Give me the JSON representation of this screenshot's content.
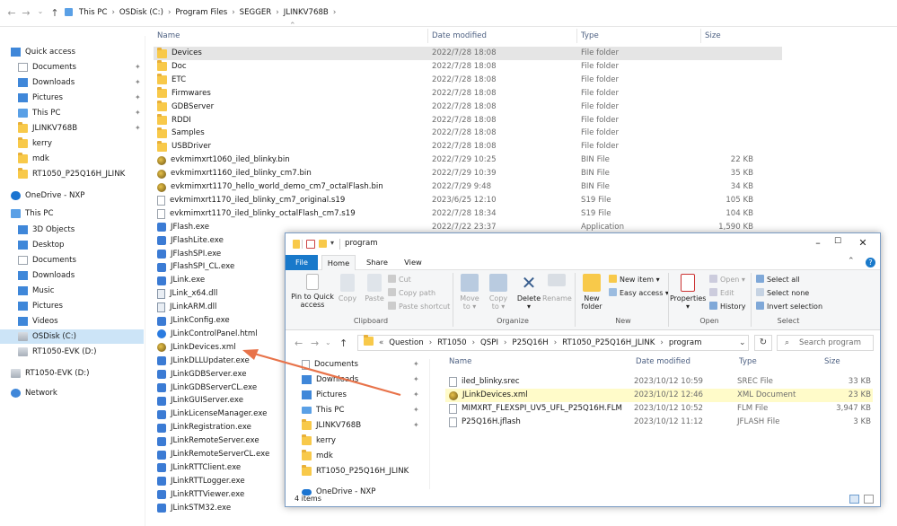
{
  "back": {
    "breadcrumb": [
      "This PC",
      "OSDisk (C:)",
      "Program Files",
      "SEGGER",
      "JLINKV768B"
    ],
    "columns": {
      "name": "Name",
      "date": "Date modified",
      "type": "Type",
      "size": "Size"
    },
    "nav": [
      {
        "label": "Quick access",
        "icon": "star-icon",
        "pin": false,
        "indent": 0
      },
      {
        "label": "Documents",
        "icon": "documents-icon",
        "pin": true,
        "indent": 1
      },
      {
        "label": "Downloads",
        "icon": "downloads-icon",
        "pin": true,
        "indent": 1
      },
      {
        "label": "Pictures",
        "icon": "pictures-icon",
        "pin": true,
        "indent": 1
      },
      {
        "label": "This PC",
        "icon": "this-pc-icon",
        "pin": true,
        "indent": 1
      },
      {
        "label": "JLINKV768B",
        "icon": "folder-icon",
        "pin": true,
        "indent": 1
      },
      {
        "label": "kerry",
        "icon": "folder-icon",
        "pin": false,
        "indent": 1
      },
      {
        "label": "mdk",
        "icon": "folder-icon",
        "pin": false,
        "indent": 1
      },
      {
        "label": "RT1050_P25Q16H_JLINK",
        "icon": "folder-icon",
        "pin": false,
        "indent": 1
      },
      {
        "label": "OneDrive - NXP",
        "icon": "cloud-icon",
        "pin": false,
        "indent": 0
      },
      {
        "label": "This PC",
        "icon": "this-pc-icon",
        "pin": false,
        "indent": 0
      },
      {
        "label": "3D Objects",
        "icon": "3d-objects-icon",
        "pin": false,
        "indent": 1
      },
      {
        "label": "Desktop",
        "icon": "desktop-icon",
        "pin": false,
        "indent": 1
      },
      {
        "label": "Documents",
        "icon": "documents-icon",
        "pin": false,
        "indent": 1
      },
      {
        "label": "Downloads",
        "icon": "downloads-icon",
        "pin": false,
        "indent": 1
      },
      {
        "label": "Music",
        "icon": "music-icon",
        "pin": false,
        "indent": 1
      },
      {
        "label": "Pictures",
        "icon": "pictures-icon",
        "pin": false,
        "indent": 1
      },
      {
        "label": "Videos",
        "icon": "videos-icon",
        "pin": false,
        "indent": 1
      },
      {
        "label": "OSDisk (C:)",
        "icon": "drive-icon",
        "pin": false,
        "indent": 1
      },
      {
        "label": "RT1050-EVK (D:)",
        "icon": "drive-icon",
        "pin": false,
        "indent": 1
      },
      {
        "label": "RT1050-EVK (D:)",
        "icon": "drive-icon",
        "pin": false,
        "indent": 0
      },
      {
        "label": "Network",
        "icon": "network-icon",
        "pin": false,
        "indent": 0
      }
    ],
    "files": [
      {
        "name": "Devices",
        "date": "2022/7/28 18:08",
        "type": "File folder",
        "size": "",
        "icon": "folder-icon"
      },
      {
        "name": "Doc",
        "date": "2022/7/28 18:08",
        "type": "File folder",
        "size": "",
        "icon": "folder-icon"
      },
      {
        "name": "ETC",
        "date": "2022/7/28 18:08",
        "type": "File folder",
        "size": "",
        "icon": "folder-icon"
      },
      {
        "name": "Firmwares",
        "date": "2022/7/28 18:08",
        "type": "File folder",
        "size": "",
        "icon": "folder-icon"
      },
      {
        "name": "GDBServer",
        "date": "2022/7/28 18:08",
        "type": "File folder",
        "size": "",
        "icon": "folder-icon"
      },
      {
        "name": "RDDI",
        "date": "2022/7/28 18:08",
        "type": "File folder",
        "size": "",
        "icon": "folder-icon"
      },
      {
        "name": "Samples",
        "date": "2022/7/28 18:08",
        "type": "File folder",
        "size": "",
        "icon": "folder-icon"
      },
      {
        "name": "USBDriver",
        "date": "2022/7/28 18:08",
        "type": "File folder",
        "size": "",
        "icon": "folder-icon"
      },
      {
        "name": "evkmimxrt1060_iled_blinky.bin",
        "date": "2022/7/29 10:25",
        "type": "BIN File",
        "size": "22 KB",
        "icon": "bin-file-icon"
      },
      {
        "name": "evkmimxrt1160_iled_blinky_cm7.bin",
        "date": "2022/7/29 10:39",
        "type": "BIN File",
        "size": "35 KB",
        "icon": "bin-file-icon"
      },
      {
        "name": "evkmimxrt1170_hello_world_demo_cm7_octalFlash.bin",
        "date": "2022/7/29 9:48",
        "type": "BIN File",
        "size": "34 KB",
        "icon": "bin-file-icon"
      },
      {
        "name": "evkmimxrt1170_iled_blinky_cm7_original.s19",
        "date": "2023/6/25 12:10",
        "type": "S19 File",
        "size": "105 KB",
        "icon": "doc-file-icon"
      },
      {
        "name": "evkmimxrt1170_iled_blinky_octalFlash_cm7.s19",
        "date": "2022/7/28 18:34",
        "type": "S19 File",
        "size": "104 KB",
        "icon": "doc-file-icon"
      },
      {
        "name": "JFlash.exe",
        "date": "2022/7/22 23:37",
        "type": "Application",
        "size": "1,590 KB",
        "icon": "exe-icon"
      },
      {
        "name": "JFlashLite.exe",
        "date": "",
        "type": "",
        "size": "",
        "icon": "exe-icon"
      },
      {
        "name": "JFlashSPI.exe",
        "date": "",
        "type": "",
        "size": "",
        "icon": "exe-icon"
      },
      {
        "name": "JFlashSPI_CL.exe",
        "date": "",
        "type": "",
        "size": "",
        "icon": "exe-icon"
      },
      {
        "name": "JLink.exe",
        "date": "",
        "type": "",
        "size": "",
        "icon": "exe-icon"
      },
      {
        "name": "JLink_x64.dll",
        "date": "",
        "type": "",
        "size": "",
        "icon": "dll-icon"
      },
      {
        "name": "JLinkARM.dll",
        "date": "",
        "type": "",
        "size": "",
        "icon": "dll-icon"
      },
      {
        "name": "JLinkConfig.exe",
        "date": "",
        "type": "",
        "size": "",
        "icon": "exe-icon"
      },
      {
        "name": "JLinkControlPanel.html",
        "date": "",
        "type": "",
        "size": "",
        "icon": "html-icon"
      },
      {
        "name": "JLinkDevices.xml",
        "date": "",
        "type": "",
        "size": "",
        "icon": "xml-file-icon"
      },
      {
        "name": "JLinkDLLUpdater.exe",
        "date": "",
        "type": "",
        "size": "",
        "icon": "exe-icon"
      },
      {
        "name": "JLinkGDBServer.exe",
        "date": "",
        "type": "",
        "size": "",
        "icon": "exe-icon"
      },
      {
        "name": "JLinkGDBServerCL.exe",
        "date": "",
        "type": "",
        "size": "",
        "icon": "exe-icon"
      },
      {
        "name": "JLinkGUIServer.exe",
        "date": "",
        "type": "",
        "size": "",
        "icon": "exe-icon"
      },
      {
        "name": "JLinkLicenseManager.exe",
        "date": "",
        "type": "",
        "size": "",
        "icon": "exe-icon"
      },
      {
        "name": "JLinkRegistration.exe",
        "date": "",
        "type": "",
        "size": "",
        "icon": "exe-icon"
      },
      {
        "name": "JLinkRemoteServer.exe",
        "date": "",
        "type": "",
        "size": "",
        "icon": "exe-icon"
      },
      {
        "name": "JLinkRemoteServerCL.exe",
        "date": "",
        "type": "",
        "size": "",
        "icon": "exe-icon"
      },
      {
        "name": "JLinkRTTClient.exe",
        "date": "",
        "type": "",
        "size": "",
        "icon": "exe-icon"
      },
      {
        "name": "JLinkRTTLogger.exe",
        "date": "",
        "type": "",
        "size": "",
        "icon": "exe-icon"
      },
      {
        "name": "JLinkRTTViewer.exe",
        "date": "",
        "type": "",
        "size": "",
        "icon": "exe-icon"
      },
      {
        "name": "JLinkSTM32.exe",
        "date": "",
        "type": "",
        "size": "",
        "icon": "exe-icon"
      }
    ]
  },
  "front": {
    "title": "program",
    "tabs": [
      "File",
      "Home",
      "Share",
      "View"
    ],
    "ribbon": {
      "pin_quick": "Pin to Quick access",
      "copy": "Copy",
      "paste": "Paste",
      "cut": "Cut",
      "copy_path": "Copy path",
      "paste_shortcut": "Paste shortcut",
      "move_to": "Move to",
      "copy_to": "Copy to",
      "delete": "Delete",
      "rename": "Rename",
      "new_folder": "New folder",
      "new_item": "New item",
      "easy_access": "Easy access",
      "properties": "Properties",
      "open": "Open",
      "edit": "Edit",
      "history": "History",
      "select_all": "Select all",
      "select_none": "Select none",
      "invert_selection": "Invert selection",
      "groups": [
        "Clipboard",
        "Organize",
        "New",
        "Open",
        "Select"
      ]
    },
    "breadcrumb": [
      "Question",
      "RT1050",
      "QSPI",
      "P25Q16H",
      "RT1050_P25Q16H_JLINK",
      "program"
    ],
    "search_placeholder": "Search program",
    "nav": [
      {
        "label": "Documents",
        "icon": "documents-icon",
        "pin": true
      },
      {
        "label": "Downloads",
        "icon": "downloads-icon",
        "pin": true
      },
      {
        "label": "Pictures",
        "icon": "pictures-icon",
        "pin": true
      },
      {
        "label": "This PC",
        "icon": "this-pc-icon",
        "pin": true
      },
      {
        "label": "JLINKV768B",
        "icon": "folder-icon",
        "pin": true
      },
      {
        "label": "kerry",
        "icon": "folder-icon",
        "pin": false
      },
      {
        "label": "mdk",
        "icon": "folder-icon",
        "pin": false
      },
      {
        "label": "RT1050_P25Q16H_JLINK",
        "icon": "folder-icon",
        "pin": false
      },
      {
        "label": "OneDrive - NXP",
        "icon": "cloud-icon",
        "pin": false
      }
    ],
    "columns": {
      "name": "Name",
      "date": "Date modified",
      "type": "Type",
      "size": "Size"
    },
    "files": [
      {
        "name": "iled_blinky.srec",
        "date": "2023/10/12 10:59",
        "type": "SREC File",
        "size": "33 KB",
        "icon": "doc-file-icon"
      },
      {
        "name": "JLinkDevices.xml",
        "date": "2023/10/12 12:46",
        "type": "XML Document",
        "size": "23 KB",
        "icon": "xml-file-icon"
      },
      {
        "name": "MIMXRT_FLEXSPI_UV5_UFL_P25Q16H.FLM",
        "date": "2023/10/12 10:52",
        "type": "FLM File",
        "size": "3,947 KB",
        "icon": "doc-file-icon"
      },
      {
        "name": "P25Q16H.jflash",
        "date": "2023/10/12 11:12",
        "type": "JFLASH File",
        "size": "3 KB",
        "icon": "doc-file-icon"
      }
    ],
    "status": "4 items"
  },
  "colors": {
    "accent": "#1979ca",
    "selection": "#cce4f7",
    "highlight": "#fffbc9",
    "arrow": "#e8734a"
  }
}
